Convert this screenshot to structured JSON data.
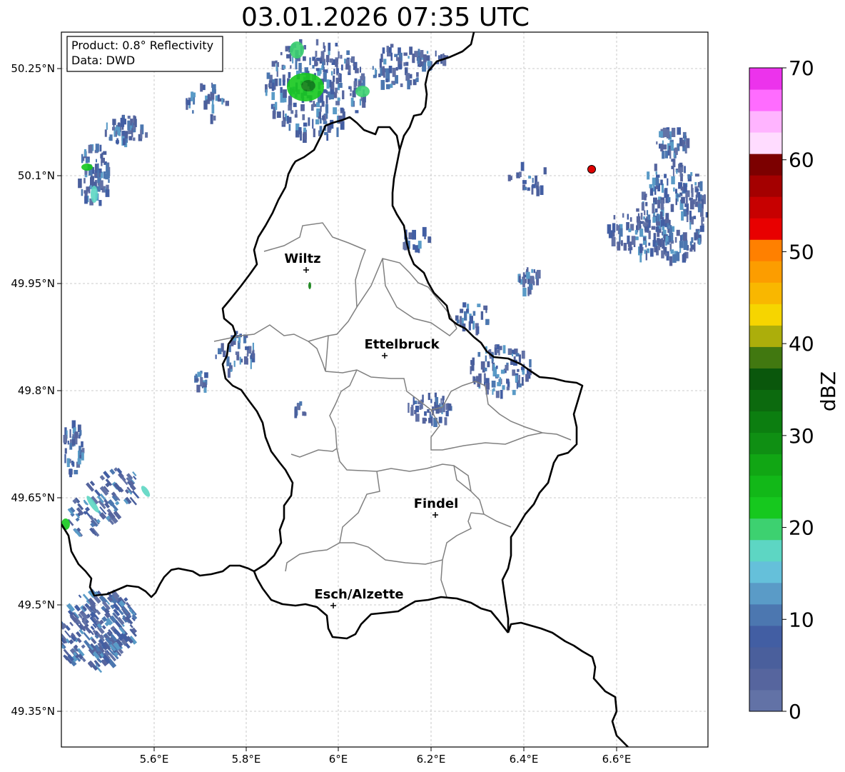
{
  "title": "03.01.2026 07:35 UTC",
  "info": {
    "product": "Product: 0.8° Reflectivity",
    "source": "Data: DWD"
  },
  "lat_ticks": [
    "50.25°N",
    "50.1°N",
    "49.95°N",
    "49.8°N",
    "49.65°N",
    "49.5°N",
    "49.35°N"
  ],
  "lon_ticks": [
    "5.6°E",
    "5.8°E",
    "6°E",
    "6.2°E",
    "6.4°E",
    "6.6°E"
  ],
  "cities": [
    {
      "name": "Wiltz",
      "lon": 5.93,
      "lat": 49.966
    },
    {
      "name": "Ettelbruck",
      "lon": 6.1,
      "lat": 49.847
    },
    {
      "name": "Findel",
      "lon": 6.21,
      "lat": 49.627
    },
    {
      "name": "Esch/Alzette",
      "lon": 5.99,
      "lat": 49.5
    }
  ],
  "radar_site": {
    "lon": 6.548,
    "lat": 50.11,
    "color": "#e00000"
  },
  "colorbar": {
    "label": "dBZ",
    "ticks": [
      "0",
      "10",
      "20",
      "30",
      "40",
      "50",
      "60",
      "70"
    ],
    "min": 0,
    "max": 70,
    "step": 2.5,
    "colors": [
      "#6272a6",
      "#56659e",
      "#4a5f9c",
      "#425ea3",
      "#4c77b0",
      "#5a9bc7",
      "#65c0da",
      "#5dd6c3",
      "#3dd170",
      "#16c81e",
      "#12b818",
      "#11a614",
      "#0f8f13",
      "#0c7e10",
      "#0c6a0e",
      "#0a570c",
      "#417810",
      "#acae0b",
      "#f6d500",
      "#f9b700",
      "#fc9d00",
      "#ff8000",
      "#e80000",
      "#c70000",
      "#a40000",
      "#7c0000",
      "#ffdcff",
      "#ffb4ff",
      "#ff6cff",
      "#ec33ec"
    ]
  }
}
